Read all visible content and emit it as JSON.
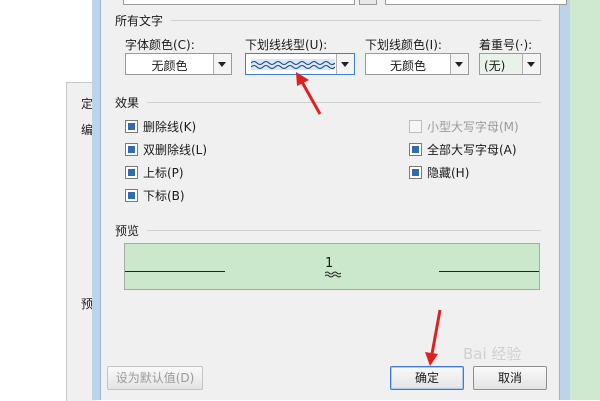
{
  "background": {
    "panel_labels": [
      "定",
      "编",
      "预"
    ]
  },
  "font_dialog": {
    "all_text_section": {
      "title": "所有文字",
      "font_color": {
        "label": "字体颜色(C):",
        "value": "无颜色"
      },
      "underline_style": {
        "label": "下划线线型(U):",
        "value": "wavy-double-underline"
      },
      "underline_color": {
        "label": "下划线颜色(I):",
        "value": "无颜色"
      },
      "emphasis_mark": {
        "label": "着重号(·):",
        "value": "(无)"
      }
    },
    "effects_section": {
      "title": "效果",
      "left": [
        {
          "label": "删除线(K)",
          "checked": true
        },
        {
          "label": "双删除线(L)",
          "checked": true
        },
        {
          "label": "上标(P)",
          "checked": true
        },
        {
          "label": "下标(B)",
          "checked": true
        }
      ],
      "right": [
        {
          "label": "小型大写字母(M)",
          "checked": false,
          "disabled": true
        },
        {
          "label": "全部大写字母(A)",
          "checked": true
        },
        {
          "label": "隐藏(H)",
          "checked": true
        }
      ]
    },
    "preview_section": {
      "title": "预览",
      "sample_text": "1"
    },
    "buttons": {
      "set_default": "设为默认值(D)",
      "ok": "确定",
      "cancel": "取消"
    }
  },
  "watermark": "Bai 经验",
  "colors": {
    "preview_bg": "#cce8cc",
    "annotation_arrow": "#e02020",
    "dialog_bg": "#f0f0f0"
  }
}
